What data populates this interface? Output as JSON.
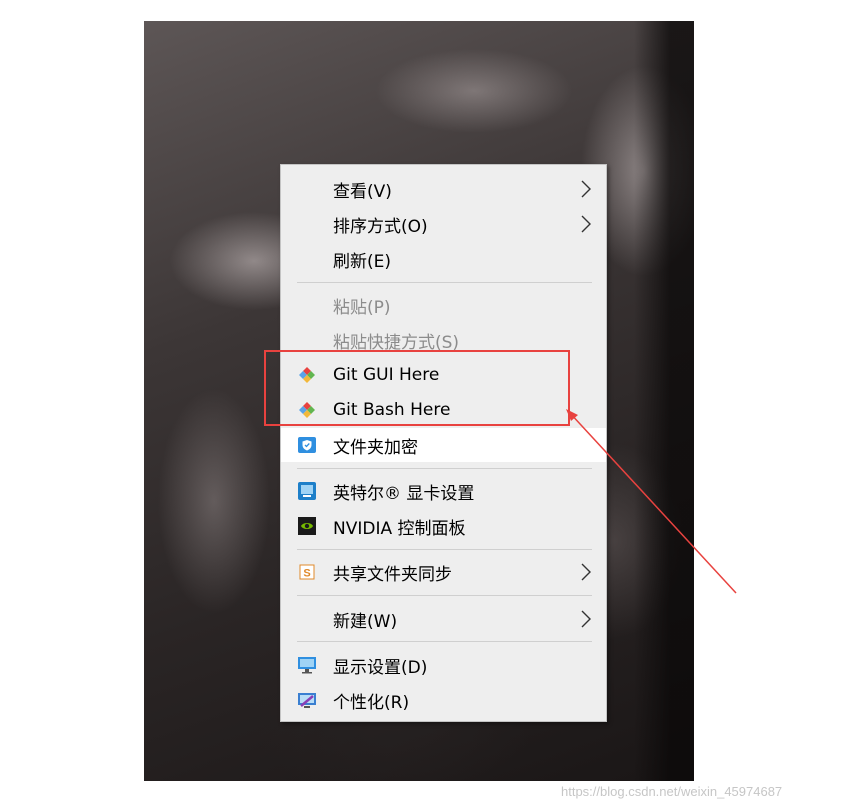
{
  "context_menu": {
    "items": [
      {
        "label": "查看(V)"
      },
      {
        "label": "排序方式(O)"
      },
      {
        "label": "刷新(E)"
      },
      {
        "label": "粘贴(P)"
      },
      {
        "label": "粘贴快捷方式(S)"
      },
      {
        "label": "Git GUI Here"
      },
      {
        "label": "Git Bash Here"
      },
      {
        "label": "文件夹加密"
      },
      {
        "label": "英特尔® 显卡设置"
      },
      {
        "label": "NVIDIA 控制面板"
      },
      {
        "label": "共享文件夹同步"
      },
      {
        "label": "新建(W)"
      },
      {
        "label": "显示设置(D)"
      },
      {
        "label": "个性化(R)"
      }
    ]
  },
  "annotation": {
    "color": "#e8423f"
  },
  "watermark": "https://blog.csdn.net/weixin_45974687"
}
